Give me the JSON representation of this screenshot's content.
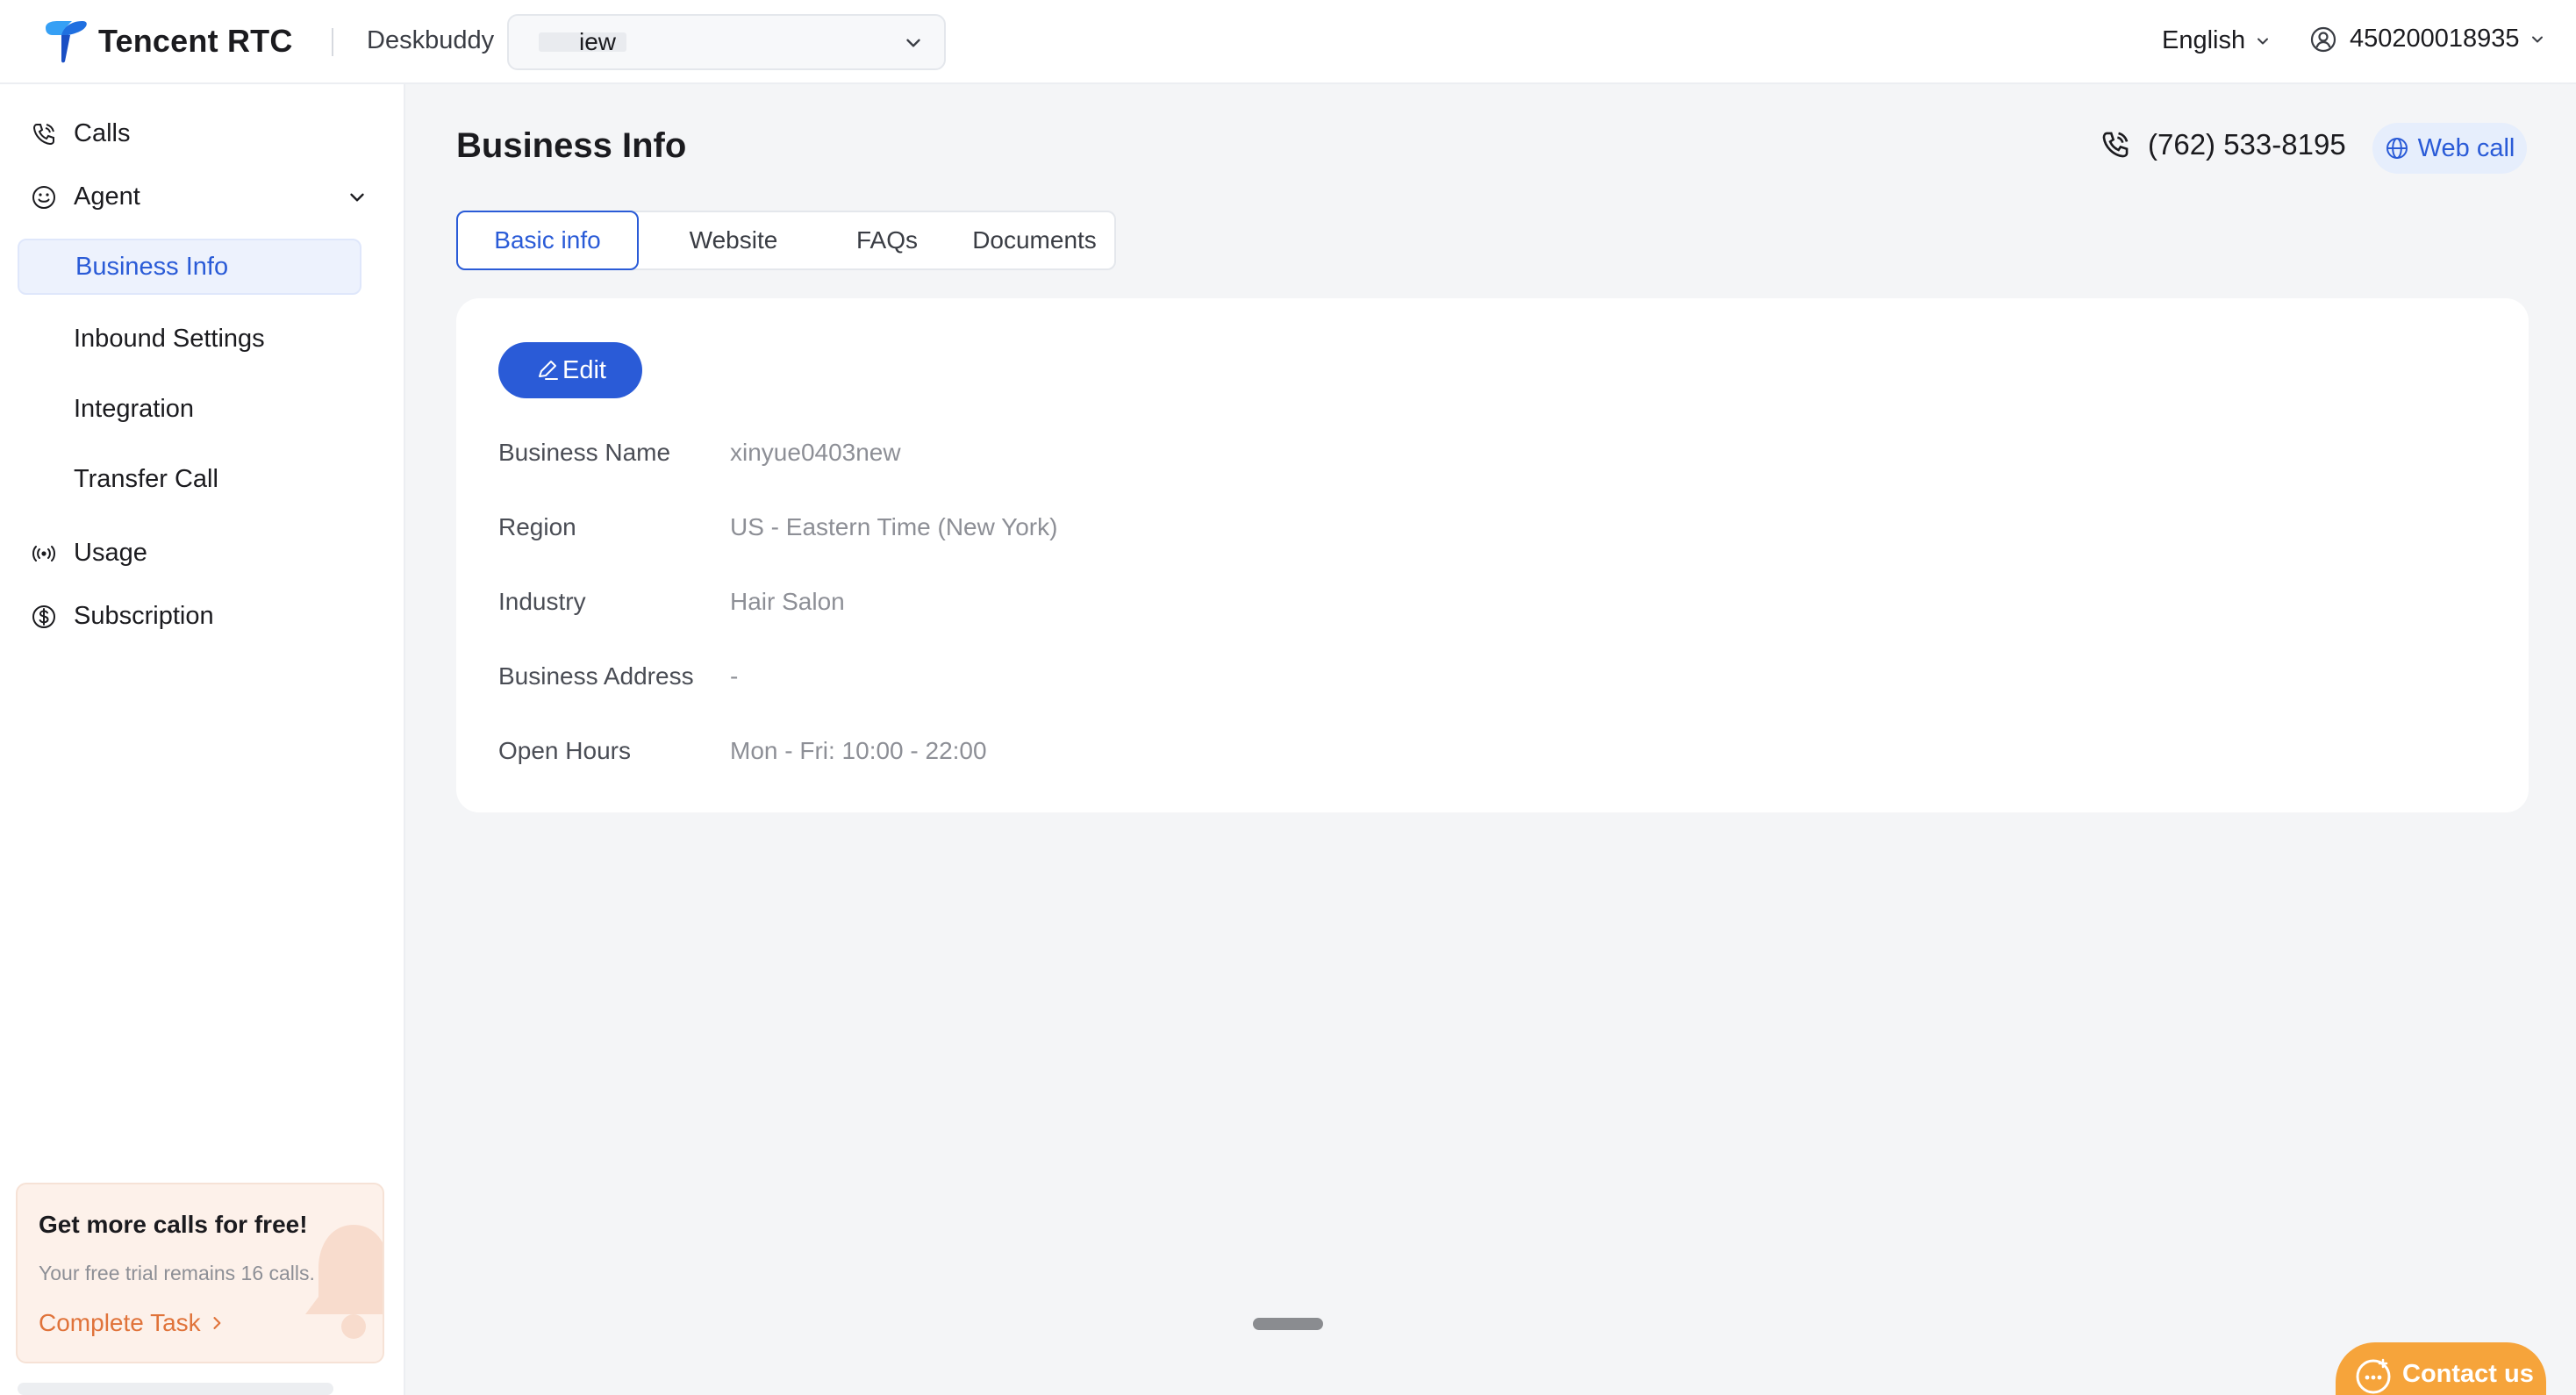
{
  "header": {
    "logo_text": "Tencent RTC",
    "product_name": "Deskbuddy",
    "agent_select_value": "iew",
    "language": "English",
    "account_id": "450200018935"
  },
  "sidebar": {
    "items": [
      {
        "label": "Calls",
        "icon": "phone-call-icon"
      },
      {
        "label": "Agent",
        "icon": "smiley-icon"
      },
      {
        "label": "Business Info",
        "active": true
      },
      {
        "label": "Inbound Settings"
      },
      {
        "label": "Integration"
      },
      {
        "label": "Transfer Call"
      },
      {
        "label": "Usage",
        "icon": "broadcast-icon"
      },
      {
        "label": "Subscription",
        "icon": "dollar-circle-icon"
      }
    ],
    "promo": {
      "title": "Get more calls for free!",
      "subtitle": "Your free trial remains 16 calls.",
      "link": "Complete Task"
    }
  },
  "main": {
    "title": "Business Info",
    "phone_number": "(762) 533-8195",
    "web_call_label": "Web call",
    "tabs": [
      {
        "label": "Basic info",
        "active": true
      },
      {
        "label": "Website"
      },
      {
        "label": "FAQs"
      },
      {
        "label": "Documents"
      }
    ],
    "edit_label": "Edit",
    "fields": [
      {
        "label": "Business Name",
        "value": "xinyue0403new"
      },
      {
        "label": "Region",
        "value": "US - Eastern Time (New York)"
      },
      {
        "label": "Industry",
        "value": "Hair Salon"
      },
      {
        "label": "Business Address",
        "value": "-"
      },
      {
        "label": "Open Hours",
        "value": "Mon - Fri: 10:00 - 22:00"
      }
    ]
  },
  "contact_label": "Contact us",
  "colors": {
    "accent": "#2a5bd7",
    "active_bg": "#edf2fd",
    "promo_bg": "#fdf1ea",
    "promo_link": "#e0733a",
    "contact_bg": "#f6a43b"
  }
}
